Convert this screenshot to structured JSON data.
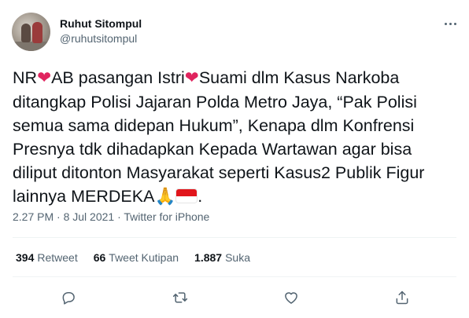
{
  "author": {
    "display_name": "Ruhut Sitompul",
    "handle": "@ruhutsitompul"
  },
  "tweet": {
    "lines": [
      [
        "NR",
        "❤",
        "AB pasangan Istri",
        "❤",
        "Suami dlm Kasus Narkoba"
      ],
      "ditangkap Polisi Jajaran Polda Metro Jaya, “Pak Polisi",
      "semua sama didepan Hukum”, Kenapa   dlm Konfrensi",
      "Presnya tdk dihadapkan Kepada Wartawan agar bisa",
      "diliput ditonton Masyarakat seperti Kasus2 Publik Figur",
      [
        "lainnya MERDEKA",
        "🙏"
      ]
    ],
    "emojis": [
      "red-heart",
      "folded-hands",
      "indonesia-flag"
    ]
  },
  "meta": {
    "time": "2.27 PM",
    "separator1": "·",
    "date": "8 Jul 2021",
    "separator2": "·",
    "source": "Twitter for iPhone"
  },
  "stats": {
    "retweets_count": "394",
    "retweets_label": "Retweet",
    "quotes_count": "66",
    "quotes_label": "Tweet Kutipan",
    "likes_count": "1.887",
    "likes_label": "Suka"
  },
  "colors": {
    "text": "#0f1419",
    "secondary": "#536471",
    "heart": "#e0245e",
    "divider": "#eff3f4"
  },
  "icons": [
    "more-icon",
    "reply-icon",
    "retweet-icon",
    "like-icon",
    "share-icon"
  ]
}
